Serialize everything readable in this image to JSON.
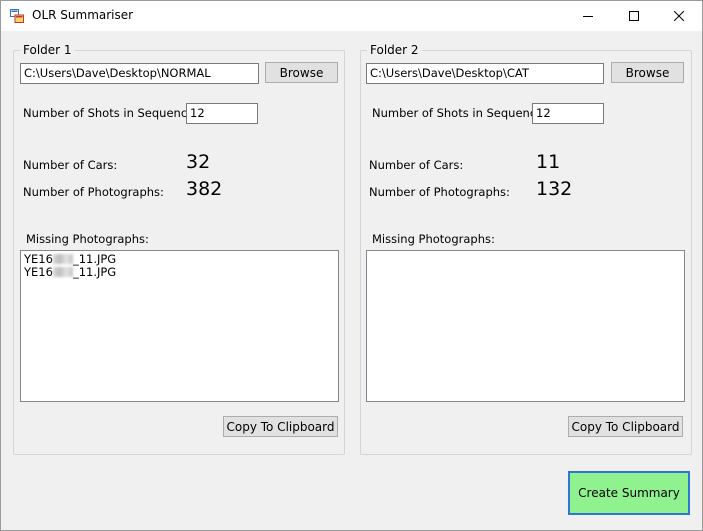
{
  "window": {
    "title": "OLR Summariser",
    "accent_color": "#2e78d2"
  },
  "folder1": {
    "legend": "Folder 1",
    "path": "C:\\Users\\Dave\\Desktop\\NORMAL",
    "browse_label": "Browse",
    "shots_label": "Number of Shots in Sequence",
    "shots_value": "12",
    "cars_label": "Number of Cars:",
    "cars_value": "32",
    "photos_label": "Number of Photographs:",
    "photos_value": "382",
    "missing_label": "Missing Photographs:",
    "missing_items": [
      {
        "prefix": "YE16",
        "suffix": "_11.JPG"
      },
      {
        "prefix": "YE16",
        "suffix": "_11.JPG"
      }
    ],
    "copy_label": "Copy To Clipboard"
  },
  "folder2": {
    "legend": "Folder 2",
    "path": "C:\\Users\\Dave\\Desktop\\CAT",
    "browse_label": "Browse",
    "shots_label": "Number of Shots in Sequence:",
    "shots_value": "12",
    "cars_label": "Number of Cars:",
    "cars_value": "11",
    "photos_label": "Number of Photographs:",
    "photos_value": "132",
    "missing_label": "Missing Photographs:",
    "missing_items": [],
    "copy_label": "Copy To Clipboard"
  },
  "actions": {
    "create_summary_label": "Create Summary",
    "create_summary_color": "#8ff28f"
  }
}
